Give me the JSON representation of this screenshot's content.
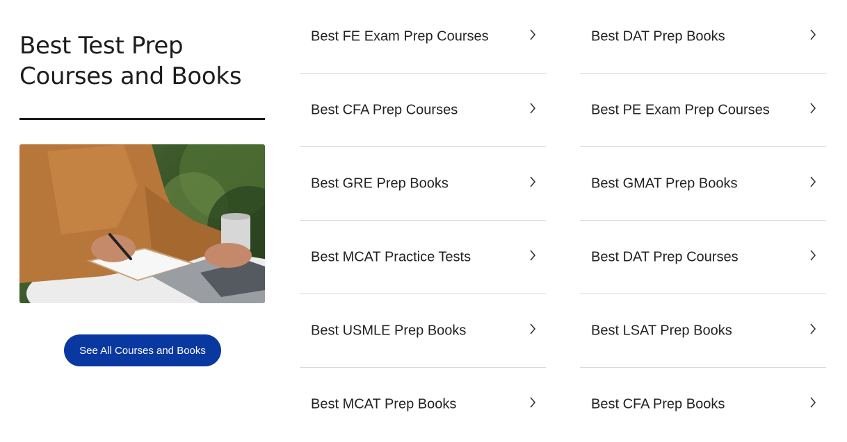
{
  "section": {
    "title": "Best Test Prep Courses and Books",
    "cta_label": "See All Courses and Books"
  },
  "links": {
    "col1": [
      {
        "label": "Best FE Exam Prep Courses"
      },
      {
        "label": "Best CFA Prep Courses"
      },
      {
        "label": "Best GRE Prep Books"
      },
      {
        "label": "Best MCAT Practice Tests"
      },
      {
        "label": "Best USMLE Prep Books"
      },
      {
        "label": "Best MCAT Prep Books"
      }
    ],
    "col2": [
      {
        "label": "Best DAT Prep Books"
      },
      {
        "label": "Best PE Exam Prep Courses"
      },
      {
        "label": "Best GMAT Prep Books"
      },
      {
        "label": "Best DAT Prep Courses"
      },
      {
        "label": "Best LSAT Prep Books"
      },
      {
        "label": "Best CFA Prep Books"
      }
    ]
  },
  "colors": {
    "button_bg": "#0a38a1",
    "text": "#1f1f1f",
    "divider": "#d8d8d8"
  },
  "icons": {
    "link_arrow": "chevron-right-icon"
  }
}
